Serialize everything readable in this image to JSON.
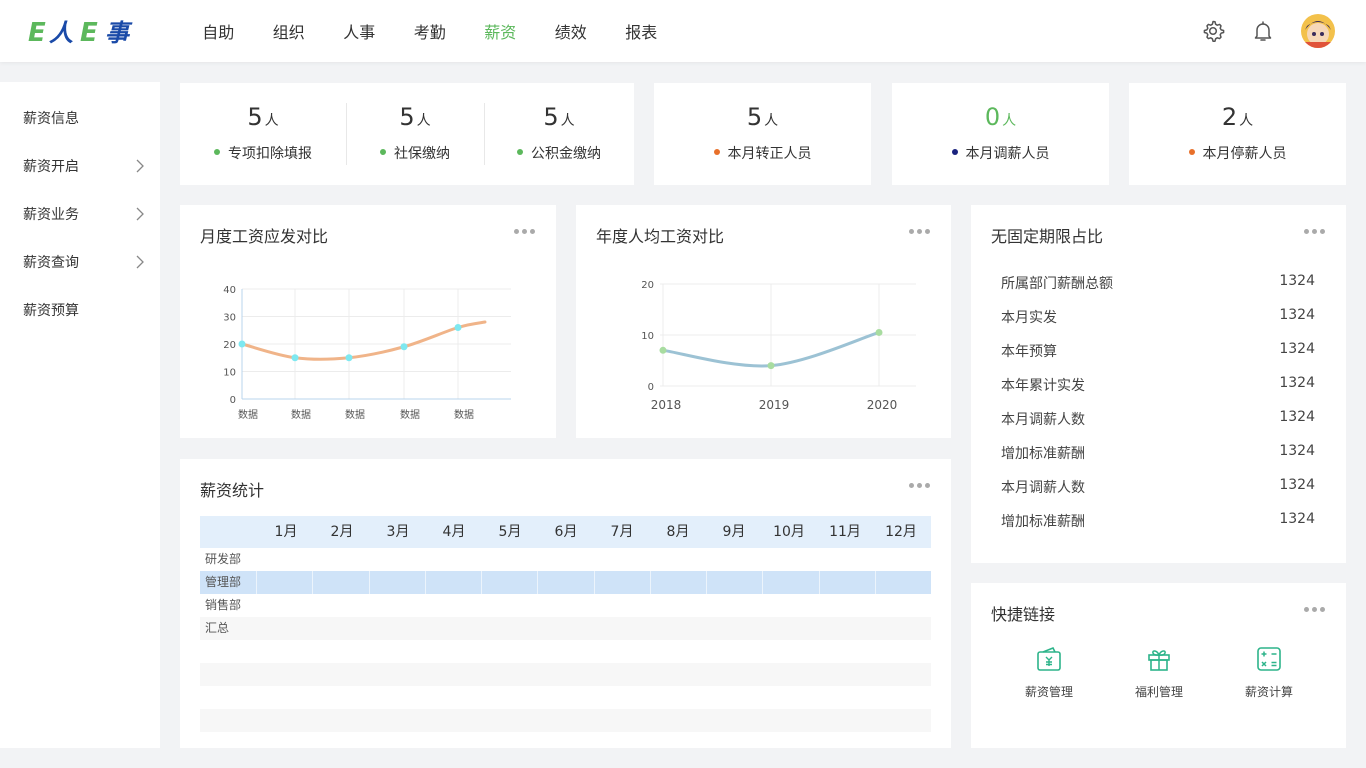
{
  "header": {
    "logo_text": "E人E事",
    "nav": [
      "自助",
      "组织",
      "人事",
      "考勤",
      "薪资",
      "绩效",
      "报表"
    ],
    "active_nav": "薪资",
    "icons": [
      "settings-gear-icon",
      "bell-icon"
    ],
    "accent_color": "#5cb85c"
  },
  "sidebar": {
    "items": [
      {
        "label": "薪资信息",
        "has_arrow": false
      },
      {
        "label": "薪资开启",
        "has_arrow": true
      },
      {
        "label": "薪资业务",
        "has_arrow": true
      },
      {
        "label": "薪资查询",
        "has_arrow": true
      },
      {
        "label": "薪资预算",
        "has_arrow": false
      }
    ]
  },
  "stats": {
    "group": [
      {
        "value": "5",
        "unit": "人",
        "label": "专项扣除填报",
        "dot_color": "#5cb85c"
      },
      {
        "value": "5",
        "unit": "人",
        "label": "社保缴纳",
        "dot_color": "#5cb85c"
      },
      {
        "value": "5",
        "unit": "人",
        "label": "公积金缴纳",
        "dot_color": "#5cb85c"
      }
    ],
    "transfer": {
      "value": "5",
      "unit": "人",
      "label": "本月转正人员",
      "dot_color": "#e8702a"
    },
    "adjust": {
      "value": "0",
      "unit": "人",
      "label": "本月调薪人员",
      "dot_color": "#1a237e"
    },
    "stop": {
      "value": "2",
      "unit": "人",
      "label": "本月停薪人员",
      "dot_color": "#e8702a"
    }
  },
  "monthly_chart": {
    "title": "月度工资应发对比",
    "chart_data": {
      "type": "line",
      "categories": [
        "数据",
        "数据",
        "数据",
        "数据",
        "数据"
      ],
      "values": [
        20,
        15,
        15,
        19,
        26,
        28
      ],
      "ylim": [
        0,
        40
      ],
      "yticks": [
        "0",
        "10",
        "20",
        "30",
        "40"
      ],
      "line_color": "#f0b489",
      "point_color": "#7ee8f0",
      "grid": true
    }
  },
  "yearly_chart": {
    "title": "年度人均工资对比",
    "chart_data": {
      "type": "line",
      "categories": [
        "2018",
        "2019",
        "2020"
      ],
      "values": [
        7,
        4,
        10.5
      ],
      "ylim": [
        0,
        20
      ],
      "yticks": [
        "0",
        "10",
        "20"
      ],
      "line_color": "#9cc2d4",
      "point_color": "#a8dca0",
      "grid": true
    }
  },
  "ratio": {
    "title": "无固定期限占比",
    "items": [
      {
        "label": "所属部门薪酬总额",
        "value": "1324"
      },
      {
        "label": "本月实发",
        "value": "1324"
      },
      {
        "label": "本年预算",
        "value": "1324"
      },
      {
        "label": "本年累计实发",
        "value": "1324"
      },
      {
        "label": "本月调薪人数",
        "value": "1324"
      },
      {
        "label": "增加标准薪酬",
        "value": "1324"
      },
      {
        "label": "本月调薪人数",
        "value": "1324"
      },
      {
        "label": "增加标准薪酬",
        "value": "1324"
      }
    ]
  },
  "salary_stats": {
    "title": "薪资统计",
    "months": [
      "1月",
      "2月",
      "3月",
      "4月",
      "5月",
      "6月",
      "7月",
      "8月",
      "9月",
      "10月",
      "11月",
      "12月"
    ],
    "rows": [
      "研发部",
      "管理部",
      "销售部",
      "汇总",
      "",
      "",
      "",
      ""
    ],
    "selected_row": "管理部"
  },
  "quick_links": {
    "title": "快捷链接",
    "items": [
      {
        "label": "薪资管理",
        "icon": "wallet-yen-icon"
      },
      {
        "label": "福利管理",
        "icon": "gift-icon"
      },
      {
        "label": "薪资计算",
        "icon": "calculator-icon"
      }
    ]
  }
}
